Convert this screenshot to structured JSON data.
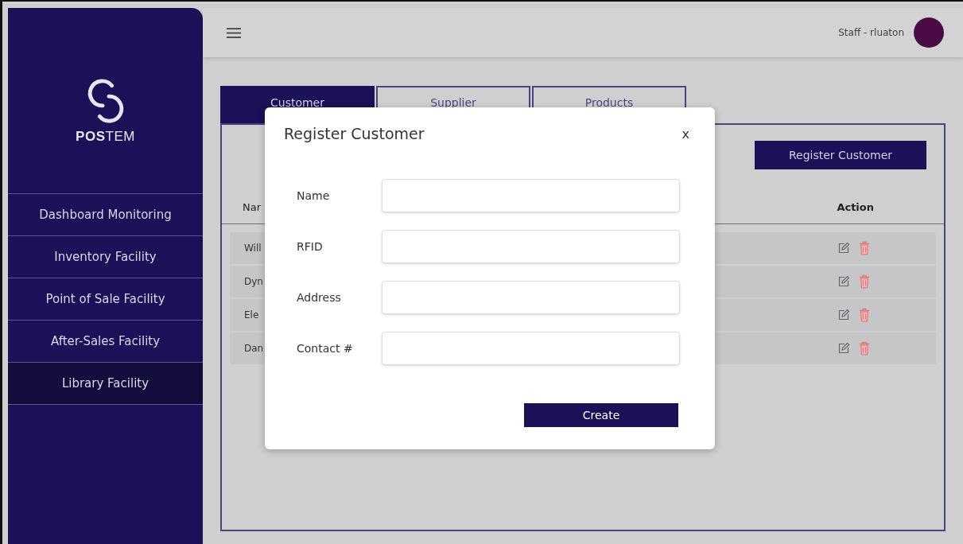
{
  "sidebar": {
    "logo": {
      "bold": "POS",
      "light": "TEM"
    },
    "items": [
      {
        "label": "Dashboard Monitoring",
        "selected": false
      },
      {
        "label": "Inventory Facility",
        "selected": false
      },
      {
        "label": "Point of Sale Facility",
        "selected": false
      },
      {
        "label": "After-Sales Facility",
        "selected": false
      },
      {
        "label": "Library Facility",
        "selected": true
      }
    ]
  },
  "topbar": {
    "user": "Staff - rluaton"
  },
  "tabs": [
    {
      "label": "Customer",
      "selected": true
    },
    {
      "label": "Supplier",
      "selected": false
    },
    {
      "label": "Products",
      "selected": false
    }
  ],
  "panel": {
    "register_button": "Register Customer",
    "columns": [
      "Nar",
      "Action"
    ],
    "rows": [
      {
        "name": "Will"
      },
      {
        "name": "Dyn"
      },
      {
        "name": "Ele"
      },
      {
        "name": "Dan"
      }
    ]
  },
  "modal": {
    "title": "Register Customer",
    "close": "x",
    "fields": [
      {
        "label": "Name"
      },
      {
        "label": "RFID"
      },
      {
        "label": "Address"
      },
      {
        "label": "Contact #"
      }
    ],
    "submit": "Create"
  }
}
